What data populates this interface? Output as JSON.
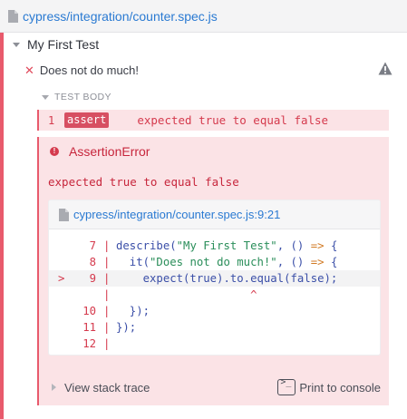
{
  "colors": {
    "link": "#2a7ad2",
    "failed": "#e85a6c",
    "error_bg": "#fbe3e6",
    "error_text": "#c7263c"
  },
  "file_bar": {
    "path": "cypress/integration/counter.spec.js",
    "icon": "file-icon"
  },
  "suite": {
    "title": "My First Test",
    "icon": "chevron-down-icon"
  },
  "test": {
    "title": "Does not do much!",
    "status_icon": "close-icon",
    "warning_icon": "warning-icon"
  },
  "test_body": {
    "label": "TEST BODY"
  },
  "command": {
    "number": "1",
    "name": "assert",
    "message": "expected true to equal false"
  },
  "error": {
    "name": "AssertionError",
    "message": "expected true to equal false",
    "codeframe": {
      "path": "cypress/integration/counter.spec.js:9:21",
      "lines": [
        {
          "marker": "",
          "number": "7",
          "bar": "|",
          "code": "describe(\"My First Test\", () => {"
        },
        {
          "marker": "",
          "number": "8",
          "bar": "|",
          "code": "  it(\"Does not do much!\", () => {"
        },
        {
          "marker": ">",
          "number": "9",
          "bar": "|",
          "code": "    expect(true).to.equal(false);"
        },
        {
          "marker": "",
          "number": "",
          "bar": "|",
          "code": "                    ^"
        },
        {
          "marker": "",
          "number": "10",
          "bar": "|",
          "code": "  });"
        },
        {
          "marker": "",
          "number": "11",
          "bar": "|",
          "code": "});"
        },
        {
          "marker": "",
          "number": "12",
          "bar": "|",
          "code": ""
        }
      ]
    },
    "stack_trace_label": "View stack trace",
    "print_label": "Print to console",
    "print_icon": "terminal-icon"
  }
}
